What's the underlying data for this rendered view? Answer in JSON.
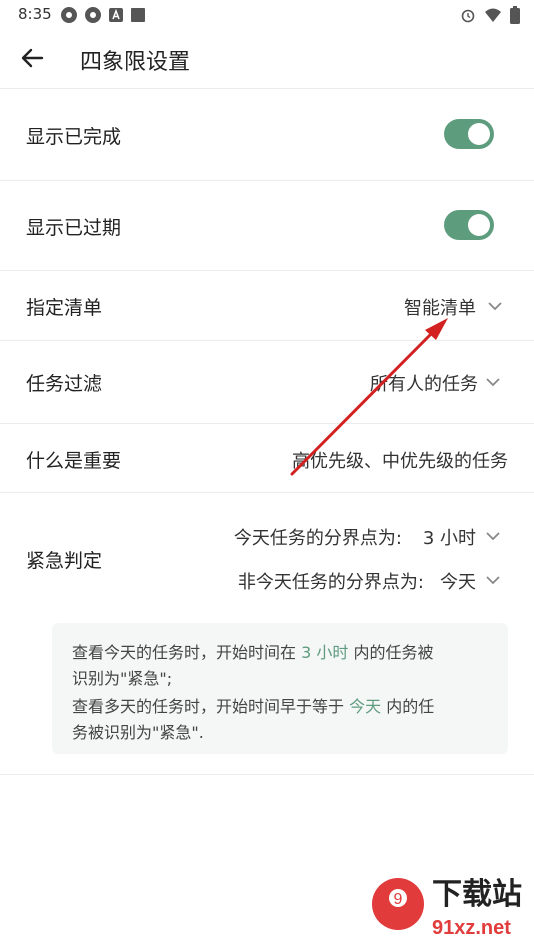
{
  "status_bar": {
    "time": "8:35"
  },
  "app_bar": {
    "title": "四象限设置"
  },
  "settings": {
    "show_completed": {
      "label": "显示已完成",
      "on": true
    },
    "show_overdue": {
      "label": "显示已过期",
      "on": true
    },
    "designated_list": {
      "label": "指定清单",
      "value": "智能清单"
    },
    "task_filter": {
      "label": "任务过滤",
      "value": "所有人的任务"
    },
    "importance": {
      "label": "什么是重要",
      "value": "高优先级、中优先级的任务"
    },
    "urgency": {
      "label": "紧急判定",
      "today_label": "今天任务的分界点为:",
      "today_value": "3 小时",
      "nontoday_label": "非今天任务的分界点为:",
      "nontoday_value": "今天"
    }
  },
  "info": {
    "line1_a": "查看今天的任务时，开始时间在",
    "line1_hl": "3 小时",
    "line1_b": "内的任务被",
    "line2": "识别为\"紧急\";",
    "line3_a": "查看多天的任务时，开始时间早于等于",
    "line3_hl": "今天",
    "line3_b": "内的任",
    "line4": "务被识别为\"紧急\"."
  },
  "watermark": {
    "brand": "下载站",
    "domain": "91xz.net"
  },
  "colors": {
    "accent": "#5e9c7e",
    "annotation_arrow": "#d32020"
  }
}
